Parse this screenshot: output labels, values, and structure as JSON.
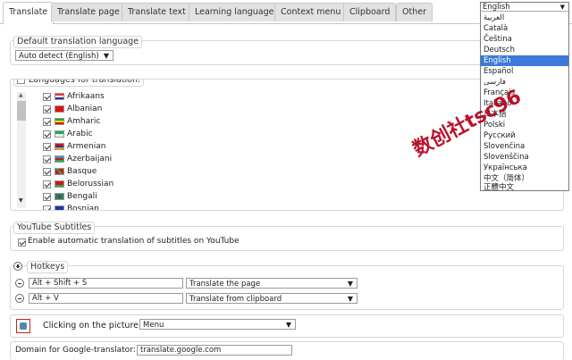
{
  "tabs": [
    "Translate",
    "Translate page",
    "Translate text",
    "Learning language",
    "Context menu",
    "Clipboard",
    "Other"
  ],
  "default_translation": {
    "legend": "Default translation language",
    "select_value": "Auto detect (English)"
  },
  "languages": {
    "legend": "Languages for translation:",
    "items": [
      "Afrikaans",
      "Albanian",
      "Amharic",
      "Arabic",
      "Armenian",
      "Azerbaijani",
      "Basque",
      "Belorussian",
      "Bengali",
      "Bosnian"
    ]
  },
  "youtube": {
    "legend": "YouTube Subtitles",
    "checkbox_label": "Enable automatic translation of subtitles on YouTube"
  },
  "hotkeys": {
    "legend": "Hotkeys",
    "rows": [
      {
        "keys": "Alt + Shift + S",
        "action": "Translate the page"
      },
      {
        "keys": "Alt + V",
        "action": "Translate from clipboard"
      }
    ]
  },
  "picture": {
    "label": "Clicking on the picture",
    "select_value": "Menu"
  },
  "domain": {
    "label": "Domain for Google-translator:",
    "value": "translate.google.com"
  },
  "ui_language_dropdown": {
    "current": "English",
    "options": [
      "العربية",
      "Català",
      "Čeština",
      "Deutsch",
      "English",
      "Español",
      "فارسی",
      "Français",
      "Italiano",
      "日本語",
      "Polski",
      "Русский",
      "Slovenčina",
      "Slovenščina",
      "Українська",
      "中文（简体）",
      "正體中文"
    ],
    "selected": "English"
  },
  "watermark": "数创社tsc96",
  "colors": {
    "selection": "#3b7ad9",
    "watermark": "#b5001a"
  }
}
